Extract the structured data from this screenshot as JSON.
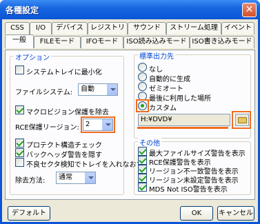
{
  "window": {
    "title": "各種設定",
    "close_glyph": "✕"
  },
  "tabs_row1": [
    "CSS",
    "I/O",
    "デバイス",
    "レジストリ",
    "サウンド",
    "ストリーム処理",
    "イベント"
  ],
  "tabs_row2": [
    "一般",
    "FILEモード",
    "IFOモード",
    "ISO読み込みモード",
    "ISO書き込みモード"
  ],
  "active_tab": "一般",
  "options": {
    "title": "オプション",
    "minimize_tray": "システムトレイに最小化",
    "filesystem_label": "ファイルシステム:",
    "filesystem_value": "自動",
    "macrovision": "マクロビジョン保護を除去",
    "rce_label": "RCE保護リージョン:",
    "rce_value": "2",
    "protect_check": "プロテクト構造チェック",
    "hide_backup": "バックヘッダ警告を隠す",
    "bad_sector": "不良セクタ検知でトレイを入れなおす",
    "removal_label": "除去方法:",
    "removal_value": "通常"
  },
  "standard_output": {
    "title": "標準出力先",
    "radios": [
      "なし",
      "自動的に生成",
      "ゼミオート",
      "最後に利用した場所",
      "カスタム"
    ],
    "selected": "カスタム",
    "path": "H:¥DVD¥"
  },
  "other": {
    "title": "その他",
    "items": [
      "最大ファイルサイズ警告を表示",
      "RCE保護警告を表示",
      "リージョン不一致警告を表示",
      "リージョン未設定警告を表示",
      "MDS Not ISO警告を表示"
    ]
  },
  "buttons": {
    "default": "デフォルト",
    "ok": "OK",
    "cancel": "キャンセル"
  }
}
